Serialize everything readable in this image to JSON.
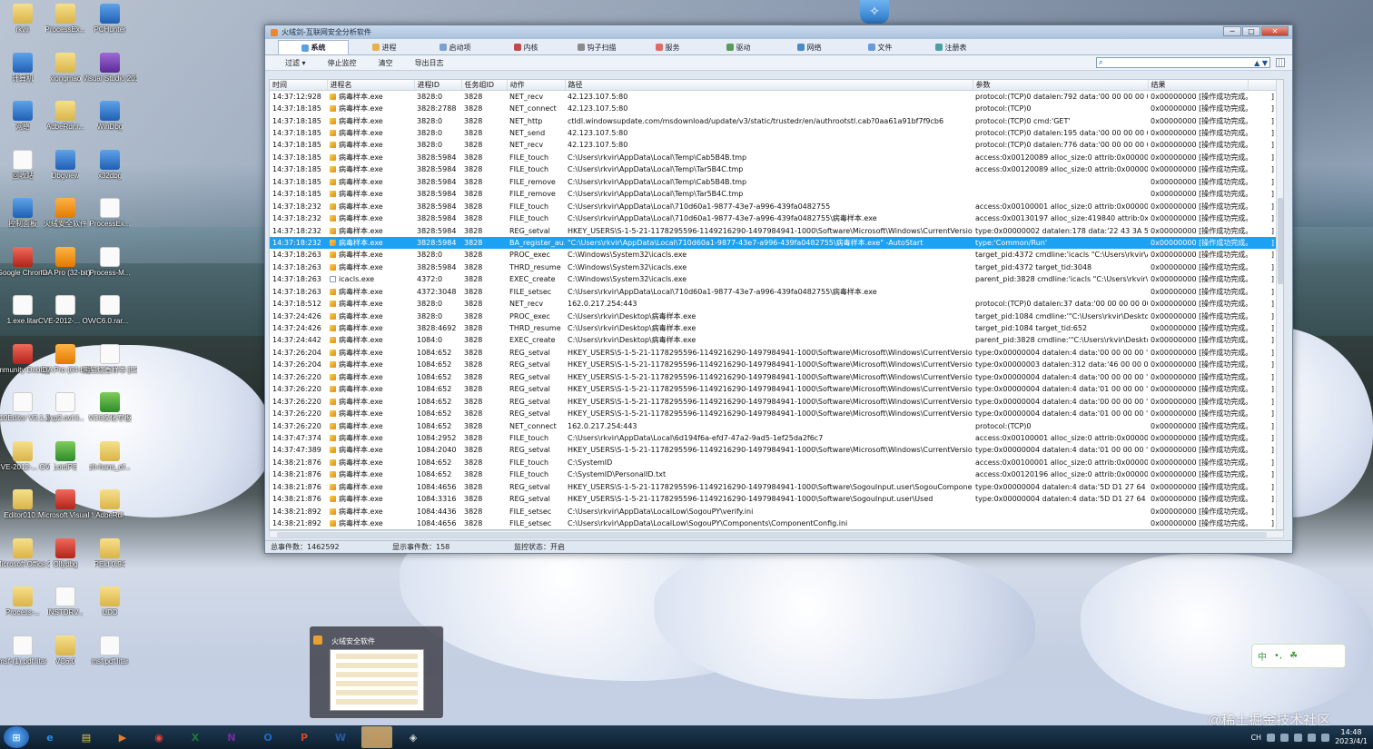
{
  "desktop": {
    "icons": [
      {
        "label": "rkvir",
        "kind": "folder"
      },
      {
        "label": "ProcessEx...",
        "kind": "folder"
      },
      {
        "label": "PCHunter",
        "kind": "app-blue"
      },
      {
        "label": "计算机",
        "kind": "app-blue"
      },
      {
        "label": "xiongmao",
        "kind": "folder"
      },
      {
        "label": "Visual Studio 2013",
        "kind": "app-purple"
      },
      {
        "label": "网络",
        "kind": "app-blue"
      },
      {
        "label": "AdbeRdr.r...",
        "kind": "folder"
      },
      {
        "label": "WinDbg",
        "kind": "app-blue"
      },
      {
        "label": "回收站",
        "kind": "file"
      },
      {
        "label": "Dbgview",
        "kind": "app-blue"
      },
      {
        "label": "x32dbg",
        "kind": "app-blue"
      },
      {
        "label": "控制面板",
        "kind": "app-blue"
      },
      {
        "label": "火绒安全软件",
        "kind": "app-orange"
      },
      {
        "label": "ProcessEx...",
        "kind": "file"
      },
      {
        "label": "Google Chrome",
        "kind": "app-red"
      },
      {
        "label": "IDA Pro (32-bit)",
        "kind": "app-orange"
      },
      {
        "label": "Process-M...",
        "kind": "file"
      },
      {
        "label": "1.exe.litar",
        "kind": "file"
      },
      {
        "label": "CVE-2012-... OVF Tools...",
        "kind": "file"
      },
      {
        "label": "VC6.0.rar...",
        "kind": "file"
      },
      {
        "label": "Immunity Debugger",
        "kind": "app-red"
      },
      {
        "label": "IDA Pro (64-bit)",
        "kind": "app-orange"
      },
      {
        "label": "熊猫烧香样本 [52pojie].zi...",
        "kind": "file"
      },
      {
        "label": "010Editor V3.1.2黑客...",
        "kind": "file"
      },
      {
        "label": "exp2.ovf.li...",
        "kind": "file"
      },
      {
        "label": "VC6汉化专板",
        "kind": "app-green"
      },
      {
        "label": "CVE-2012-... OVF Tools...",
        "kind": "folder"
      },
      {
        "label": "LordPE",
        "kind": "app-green"
      },
      {
        "label": "zh-hans_of...",
        "kind": "folder"
      },
      {
        "label": "Editor010...",
        "kind": "folder"
      },
      {
        "label": "Microsoft Visual Stu...",
        "kind": "app-red"
      },
      {
        "label": "AdbeRdr",
        "kind": "folder"
      },
      {
        "label": "Microsoft Office 2003",
        "kind": "folder"
      },
      {
        "label": "Ollydbg",
        "kind": "app-red"
      },
      {
        "label": "PEid 0.94",
        "kind": "folder"
      },
      {
        "label": "Process-...",
        "kind": "folder"
      },
      {
        "label": "INSTDRV...",
        "kind": "file"
      },
      {
        "label": "UDD",
        "kind": "folder"
      },
      {
        "label": "msf-(1).pdf.litar",
        "kind": "file"
      },
      {
        "label": "VC6.0",
        "kind": "folder"
      },
      {
        "label": "msf.pdf.litar",
        "kind": "file"
      }
    ]
  },
  "window": {
    "title": "火绒剑-互联网安全分析软件",
    "controls": {
      "minimize": "─",
      "maximize": "□",
      "close": "✕"
    },
    "tabs": [
      "系统",
      "进程",
      "启动项",
      "内核",
      "钩子扫描",
      "服务",
      "驱动",
      "网络",
      "文件",
      "注册表"
    ],
    "active_tab": "系统",
    "toolbar": {
      "filter": "过滤 ▾",
      "stop": "停止监控",
      "clear": "清空",
      "export": "导出日志"
    },
    "search": {
      "value": "",
      "placeholder": "",
      "up": "▲",
      "down": "▼",
      "icon": "⌕"
    },
    "columns": [
      "时间",
      "进程名",
      "进程ID",
      "任务组ID",
      "动作",
      "路径",
      "参数",
      "结果"
    ],
    "selected_row": 12,
    "rows": [
      [
        "14:37:12:928",
        "病毒样本.exe",
        "3828:0",
        "3828",
        "NET_recv",
        "42.123.107.5:80",
        "protocol:(TCP)0 datalen:792 data:'00 00 00 00 00...",
        "0x00000000 [操作成功完成。",
        ""
      ],
      [
        "14:37:18:185",
        "病毒样本.exe",
        "3828:2788",
        "3828",
        "NET_connect",
        "42.123.107.5:80",
        "protocol:(TCP)0",
        "0x00000000 [操作成功完成。",
        ""
      ],
      [
        "14:37:18:185",
        "病毒样本.exe",
        "3828:0",
        "3828",
        "NET_http",
        "ctldl.windowsupdate.com/msdownload/update/v3/static/trustedr/en/authrootstl.cab?0aa61a91bf7f9cb6",
        "protocol:(TCP)0 cmd:'GET'",
        "0x00000000 [操作成功完成。",
        ""
      ],
      [
        "14:37:18:185",
        "病毒样本.exe",
        "3828:0",
        "3828",
        "NET_send",
        "42.123.107.5:80",
        "protocol:(TCP)0 datalen:195 data:'00 00 00 00 00...",
        "0x00000000 [操作成功完成。",
        ""
      ],
      [
        "14:37:18:185",
        "病毒样本.exe",
        "3828:0",
        "3828",
        "NET_recv",
        "42.123.107.5:80",
        "protocol:(TCP)0 datalen:776 data:'00 00 00 00 00...",
        "0x00000000 [操作成功完成。",
        ""
      ],
      [
        "14:37:18:185",
        "病毒样本.exe",
        "3828:5984",
        "3828",
        "FILE_touch",
        "C:\\Users\\rkvir\\AppData\\Local\\Temp\\Cab5B4B.tmp",
        "access:0x00120089 alloc_size:0 attrib:0x00000080...",
        "0x00000000 [操作成功完成。",
        ""
      ],
      [
        "14:37:18:185",
        "病毒样本.exe",
        "3828:5984",
        "3828",
        "FILE_touch",
        "C:\\Users\\rkvir\\AppData\\Local\\Temp\\Tar5B4C.tmp",
        "access:0x00120089 alloc_size:0 attrib:0x00000080...",
        "0x00000000 [操作成功完成。",
        ""
      ],
      [
        "14:37:18:185",
        "病毒样本.exe",
        "3828:5984",
        "3828",
        "FILE_remove",
        "C:\\Users\\rkvir\\AppData\\Local\\Temp\\Cab5B4B.tmp",
        "",
        "0x00000000 [操作成功完成。",
        ""
      ],
      [
        "14:37:18:185",
        "病毒样本.exe",
        "3828:5984",
        "3828",
        "FILE_remove",
        "C:\\Users\\rkvir\\AppData\\Local\\Temp\\Tar5B4C.tmp",
        "",
        "0x00000000 [操作成功完成。",
        ""
      ],
      [
        "14:37:18:232",
        "病毒样本.exe",
        "3828:5984",
        "3828",
        "FILE_touch",
        "C:\\Users\\rkvir\\AppData\\Local\\710d60a1-9877-43e7-a996-439fa0482755",
        "access:0x00100001 alloc_size:0 attrib:0x00000080...",
        "0x00000000 [操作成功完成。",
        ""
      ],
      [
        "14:37:18:232",
        "病毒样本.exe",
        "3828:5984",
        "3828",
        "FILE_touch",
        "C:\\Users\\rkvir\\AppData\\Local\\710d60a1-9877-43e7-a996-439fa0482755\\病毒样本.exe",
        "access:0x00130197 alloc_size:419840 attrib:0x000...",
        "0x00000000 [操作成功完成。",
        ""
      ],
      [
        "14:37:18:232",
        "病毒样本.exe",
        "3828:5984",
        "3828",
        "REG_setval",
        "HKEY_USERS\\S-1-5-21-1178295596-1149216290-1497984941-1000\\Software\\Microsoft\\Windows\\CurrentVersion\\Run\\...",
        "type:0x00000002 datalen:178 data:'22 43 3A 5C 5...",
        "0x00000000 [操作成功完成。",
        ""
      ],
      [
        "14:37:18:232",
        "病毒样本.exe",
        "3828:5984",
        "3828",
        "BA_register_au...",
        "\"C:\\Users\\rkvir\\AppData\\Local\\710d60a1-9877-43e7-a996-439fa0482755\\病毒样本.exe\" -AutoStart",
        "type:'Common/Run'",
        "0x00000000 [操作成功完成。",
        ""
      ],
      [
        "14:37:18:263",
        "病毒样本.exe",
        "3828:0",
        "3828",
        "PROC_exec",
        "C:\\Windows\\System32\\icacls.exe",
        "target_pid:4372 cmdline:'icacls \"C:\\Users\\rkvir\\Ap...",
        "0x00000000 [操作成功完成。",
        ""
      ],
      [
        "14:37:18:263",
        "病毒样本.exe",
        "3828:5984",
        "3828",
        "THRD_resume",
        "C:\\Windows\\System32\\icacls.exe",
        "target_pid:4372 target_tid:3048",
        "0x00000000 [操作成功完成。",
        ""
      ],
      [
        "14:37:18:263",
        "icacls.exe",
        "4372:0",
        "3828",
        "EXEC_create",
        "C:\\Windows\\System32\\icacls.exe",
        "parent_pid:3828 cmdline:'icacls \"C:\\Users\\rkvir\\A...",
        "0x00000000 [操作成功完成。",
        ""
      ],
      [
        "14:37:18:263",
        "病毒样本.exe",
        "4372:3048",
        "3828",
        "FILE_setsec",
        "C:\\Users\\rkvir\\AppData\\Local\\710d60a1-9877-43e7-a996-439fa0482755\\病毒样本.exe",
        "",
        "0x00000000 [操作成功完成。",
        ""
      ],
      [
        "14:37:18:512",
        "病毒样本.exe",
        "3828:0",
        "3828",
        "NET_recv",
        "162.0.217.254:443",
        "protocol:(TCP)0 datalen:37 data:'00 00 00 00 00 ...",
        "0x00000000 [操作成功完成。",
        ""
      ],
      [
        "14:37:24:426",
        "病毒样本.exe",
        "3828:0",
        "3828",
        "PROC_exec",
        "C:\\Users\\rkvir\\Desktop\\病毒样本.exe",
        "target_pid:1084 cmdline:'\"C:\\Users\\rkvir\\Desktop...",
        "0x00000000 [操作成功完成。",
        ""
      ],
      [
        "14:37:24:426",
        "病毒样本.exe",
        "3828:4692",
        "3828",
        "THRD_resume",
        "C:\\Users\\rkvir\\Desktop\\病毒样本.exe",
        "target_pid:1084 target_tid:652",
        "0x00000000 [操作成功完成。",
        ""
      ],
      [
        "14:37:24:442",
        "病毒样本.exe",
        "1084:0",
        "3828",
        "EXEC_create",
        "C:\\Users\\rkvir\\Desktop\\病毒样本.exe",
        "parent_pid:3828 cmdline:'\"C:\\Users\\rkvir\\Deskto...",
        "0x00000000 [操作成功完成。",
        ""
      ],
      [
        "14:37:26:204",
        "病毒样本.exe",
        "1084:652",
        "3828",
        "REG_setval",
        "HKEY_USERS\\S-1-5-21-1178295596-1149216290-1497984941-1000\\Software\\Microsoft\\Windows\\CurrentVersion\\Inter...",
        "type:0x00000004 datalen:4 data:'00 00 00 00 '",
        "0x00000000 [操作成功完成。",
        ""
      ],
      [
        "14:37:26:204",
        "病毒样本.exe",
        "1084:652",
        "3828",
        "REG_setval",
        "HKEY_USERS\\S-1-5-21-1178295596-1149216290-1497984941-1000\\Software\\Microsoft\\Windows\\CurrentVersion\\Inter...",
        "type:0x00000003 datalen:312 data:'46 00 00 00 7...",
        "0x00000000 [操作成功完成。",
        ""
      ],
      [
        "14:37:26:220",
        "病毒样本.exe",
        "1084:652",
        "3828",
        "REG_setval",
        "HKEY_USERS\\S-1-5-21-1178295596-1149216290-1497984941-1000\\Software\\Microsoft\\Windows\\CurrentVersion\\Inter...",
        "type:0x00000004 datalen:4 data:'00 00 00 00 '",
        "0x00000000 [操作成功完成。",
        ""
      ],
      [
        "14:37:26:220",
        "病毒样本.exe",
        "1084:652",
        "3828",
        "REG_setval",
        "HKEY_USERS\\S-1-5-21-1178295596-1149216290-1497984941-1000\\Software\\Microsoft\\Windows\\CurrentVersion\\Inter...",
        "type:0x00000004 datalen:4 data:'01 00 00 00 '",
        "0x00000000 [操作成功完成。",
        ""
      ],
      [
        "14:37:26:220",
        "病毒样本.exe",
        "1084:652",
        "3828",
        "REG_setval",
        "HKEY_USERS\\S-1-5-21-1178295596-1149216290-1497984941-1000\\Software\\Microsoft\\Windows\\CurrentVersion\\Inter...",
        "type:0x00000004 datalen:4 data:'00 00 00 00 '",
        "0x00000000 [操作成功完成。",
        ""
      ],
      [
        "14:37:26:220",
        "病毒样本.exe",
        "1084:652",
        "3828",
        "REG_setval",
        "HKEY_USERS\\S-1-5-21-1178295596-1149216290-1497984941-1000\\Software\\Microsoft\\Windows\\CurrentVersion\\Inter...",
        "type:0x00000004 datalen:4 data:'01 00 00 00 '",
        "0x00000000 [操作成功完成。",
        ""
      ],
      [
        "14:37:26:220",
        "病毒样本.exe",
        "1084:652",
        "3828",
        "NET_connect",
        "162.0.217.254:443",
        "protocol:(TCP)0",
        "0x00000000 [操作成功完成。",
        ""
      ],
      [
        "14:37:47:374",
        "病毒样本.exe",
        "1084:2952",
        "3828",
        "FILE_touch",
        "C:\\Users\\rkvir\\AppData\\Local\\6d194f6a-efd7-47a2-9ad5-1ef25da2f6c7",
        "access:0x00100001 alloc_size:0 attrib:0x00000080...",
        "0x00000000 [操作成功完成。",
        ""
      ],
      [
        "14:37:47:389",
        "病毒样本.exe",
        "1084:2040",
        "3828",
        "REG_setval",
        "HKEY_USERS\\S-1-5-21-1178295596-1149216290-1497984941-1000\\Software\\Microsoft\\Windows\\CurrentVersion\\Sys...",
        "type:0x00000004 datalen:4 data:'01 00 00 00 '",
        "0x00000000 [操作成功完成。",
        ""
      ],
      [
        "14:38:21:876",
        "病毒样本.exe",
        "1084:652",
        "3828",
        "FILE_touch",
        "C:\\SystemID",
        "access:0x00100001 alloc_size:0 attrib:0x00000080...",
        "0x00000000 [操作成功完成。",
        ""
      ],
      [
        "14:38:21:876",
        "病毒样本.exe",
        "1084:652",
        "3828",
        "FILE_touch",
        "C:\\SystemID\\PersonalID.txt",
        "access:0x00120196 alloc_size:0 attrib:0x00000080...",
        "0x00000000 [操作成功完成。",
        ""
      ],
      [
        "14:38:21:876",
        "病毒样本.exe",
        "1084:4656",
        "3828",
        "REG_setval",
        "HKEY_USERS\\S-1-5-21-1178295596-1149216290-1497984941-1000\\Software\\SogouInput.user\\SogouComponentFirstL...",
        "type:0x00000004 datalen:4 data:'5D D1 27 64 '",
        "0x00000000 [操作成功完成。",
        ""
      ],
      [
        "14:38:21:876",
        "病毒样本.exe",
        "1084:3316",
        "3828",
        "REG_setval",
        "HKEY_USERS\\S-1-5-21-1178295596-1149216290-1497984941-1000\\Software\\SogouInput.user\\Used",
        "type:0x00000004 datalen:4 data:'5D D1 27 64 '",
        "0x00000000 [操作成功完成。",
        ""
      ],
      [
        "14:38:21:892",
        "病毒样本.exe",
        "1084:4436",
        "3828",
        "FILE_setsec",
        "C:\\Users\\rkvir\\AppData\\LocalLow\\SogouPY\\verify.ini",
        "",
        "0x00000000 [操作成功完成。",
        ""
      ],
      [
        "14:38:21:892",
        "病毒样本.exe",
        "1084:4656",
        "3828",
        "FILE_setsec",
        "C:\\Users\\rkvir\\AppData\\LocalLow\\SogouPY\\Components\\ComponentConfig.ini",
        "",
        "0x00000000 [操作成功完成。",
        ""
      ]
    ],
    "row_end_mark": "]",
    "status": {
      "total": "总事件数：1462592",
      "shown": "显示事件数：158",
      "monitor": "监控状态：开启"
    }
  },
  "preview": {
    "title": "火绒安全软件"
  },
  "ime": {
    "mode": "中",
    "icons": [
      "•,",
      "☘"
    ]
  },
  "watermark": "@稀土掘金技术社区",
  "taskbar": {
    "start_icon": "⊞",
    "apps": [
      {
        "name": "ie-icon",
        "glyph": "e",
        "color": "#2a8ee8"
      },
      {
        "name": "explorer-icon",
        "glyph": "▤",
        "color": "#e8c25a"
      },
      {
        "name": "media-icon",
        "glyph": "▶",
        "color": "#e87a2a"
      },
      {
        "name": "chrome-icon",
        "glyph": "◉",
        "color": "#e8453c"
      },
      {
        "name": "excel-icon",
        "glyph": "X",
        "color": "#1f7a3a"
      },
      {
        "name": "onenote-icon",
        "glyph": "N",
        "color": "#7a2aa8"
      },
      {
        "name": "outlook-icon",
        "glyph": "O",
        "color": "#1f6ac8"
      },
      {
        "name": "powerpoint-icon",
        "glyph": "P",
        "color": "#d24726"
      },
      {
        "name": "word-icon",
        "glyph": "W",
        "color": "#2b5aa8"
      },
      {
        "name": "huorong-icon",
        "glyph": "♨",
        "color": "#e98a2a"
      },
      {
        "name": "huorongjian-icon",
        "glyph": "◈",
        "color": "#d8d8d8"
      }
    ],
    "clock": {
      "time": "14:48",
      "date": "2023/4/1"
    },
    "tray_text": "CH"
  }
}
